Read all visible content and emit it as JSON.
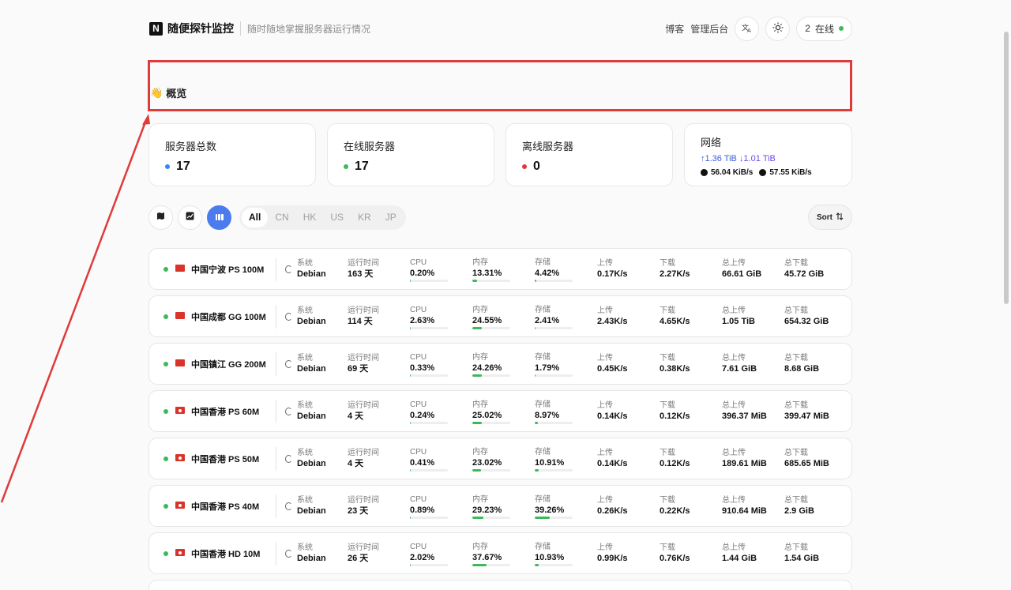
{
  "header": {
    "logo_text": "N",
    "title": "随便探针监控",
    "subtitle": "随时随地掌握服务器运行情况",
    "blog": "博客",
    "admin": "管理后台",
    "translate_icon": "translate-icon",
    "theme_icon": "sun-icon",
    "online_count": "2",
    "online_label": "在线"
  },
  "overview": {
    "emoji": "👋",
    "title": "概览"
  },
  "stats": {
    "total": {
      "label": "服务器总数",
      "value": "17",
      "color": "#3b82f6"
    },
    "online": {
      "label": "在线服务器",
      "value": "17",
      "color": "#3cb95a"
    },
    "offline": {
      "label": "离线服务器",
      "value": "0",
      "color": "#e03a3a"
    },
    "network": {
      "label": "网络",
      "up_total": "↑1.36 TiB",
      "down_total": "↓1.01 TiB",
      "up_speed": "56.04 KiB/s",
      "down_speed": "57.55 KiB/s"
    }
  },
  "toolbar": {
    "view_buttons": [
      "map-view",
      "chart-view",
      "grid-view"
    ],
    "tags": [
      "All",
      "CN",
      "HK",
      "US",
      "KR",
      "JP"
    ],
    "active_tag": "All",
    "sort_label": "Sort"
  },
  "columns": {
    "os": "系统",
    "uptime": "运行时间",
    "cpu": "CPU",
    "mem": "内存",
    "disk": "存储",
    "up": "上传",
    "down": "下载",
    "total_up": "总上传",
    "total_down": "总下载"
  },
  "servers": [
    {
      "flag": "cn",
      "name": "中国宁波 PS 100M",
      "os": "Debian",
      "uptime": "163 天",
      "cpu": "0.20%",
      "cpu_pct": 0.2,
      "mem": "13.31%",
      "mem_pct": 13.31,
      "disk": "4.42%",
      "disk_pct": 4.42,
      "up": "0.17K/s",
      "down": "2.27K/s",
      "total_up": "66.61 GiB",
      "total_down": "45.72 GiB"
    },
    {
      "flag": "cn",
      "name": "中国成都 GG 100M",
      "os": "Debian",
      "uptime": "114 天",
      "cpu": "2.63%",
      "cpu_pct": 2.63,
      "mem": "24.55%",
      "mem_pct": 24.55,
      "disk": "2.41%",
      "disk_pct": 2.41,
      "up": "2.43K/s",
      "down": "4.65K/s",
      "total_up": "1.05 TiB",
      "total_down": "654.32 GiB"
    },
    {
      "flag": "cn",
      "name": "中国镇江 GG 200M",
      "os": "Debian",
      "uptime": "69 天",
      "cpu": "0.33%",
      "cpu_pct": 0.33,
      "mem": "24.26%",
      "mem_pct": 24.26,
      "disk": "1.79%",
      "disk_pct": 1.79,
      "up": "0.45K/s",
      "down": "0.38K/s",
      "total_up": "7.61 GiB",
      "total_down": "8.68 GiB"
    },
    {
      "flag": "hk",
      "name": "中国香港 PS 60M",
      "os": "Debian",
      "uptime": "4 天",
      "cpu": "0.24%",
      "cpu_pct": 0.24,
      "mem": "25.02%",
      "mem_pct": 25.02,
      "disk": "8.97%",
      "disk_pct": 8.97,
      "up": "0.14K/s",
      "down": "0.12K/s",
      "total_up": "396.37 MiB",
      "total_down": "399.47 MiB"
    },
    {
      "flag": "hk",
      "name": "中国香港 PS 50M",
      "os": "Debian",
      "uptime": "4 天",
      "cpu": "0.41%",
      "cpu_pct": 0.41,
      "mem": "23.02%",
      "mem_pct": 23.02,
      "disk": "10.91%",
      "disk_pct": 10.91,
      "up": "0.14K/s",
      "down": "0.12K/s",
      "total_up": "189.61 MiB",
      "total_down": "685.65 MiB"
    },
    {
      "flag": "hk",
      "name": "中国香港 PS 40M",
      "os": "Debian",
      "uptime": "23 天",
      "cpu": "0.89%",
      "cpu_pct": 0.89,
      "mem": "29.23%",
      "mem_pct": 29.23,
      "disk": "39.26%",
      "disk_pct": 39.26,
      "up": "0.26K/s",
      "down": "0.22K/s",
      "total_up": "910.64 MiB",
      "total_down": "2.9 GiB"
    },
    {
      "flag": "hk",
      "name": "中国香港 HD 10M",
      "os": "Debian",
      "uptime": "26 天",
      "cpu": "2.02%",
      "cpu_pct": 2.02,
      "mem": "37.67%",
      "mem_pct": 37.67,
      "disk": "10.93%",
      "disk_pct": 10.93,
      "up": "0.99K/s",
      "down": "0.76K/s",
      "total_up": "1.44 GiB",
      "total_down": "1.54 GiB"
    }
  ]
}
